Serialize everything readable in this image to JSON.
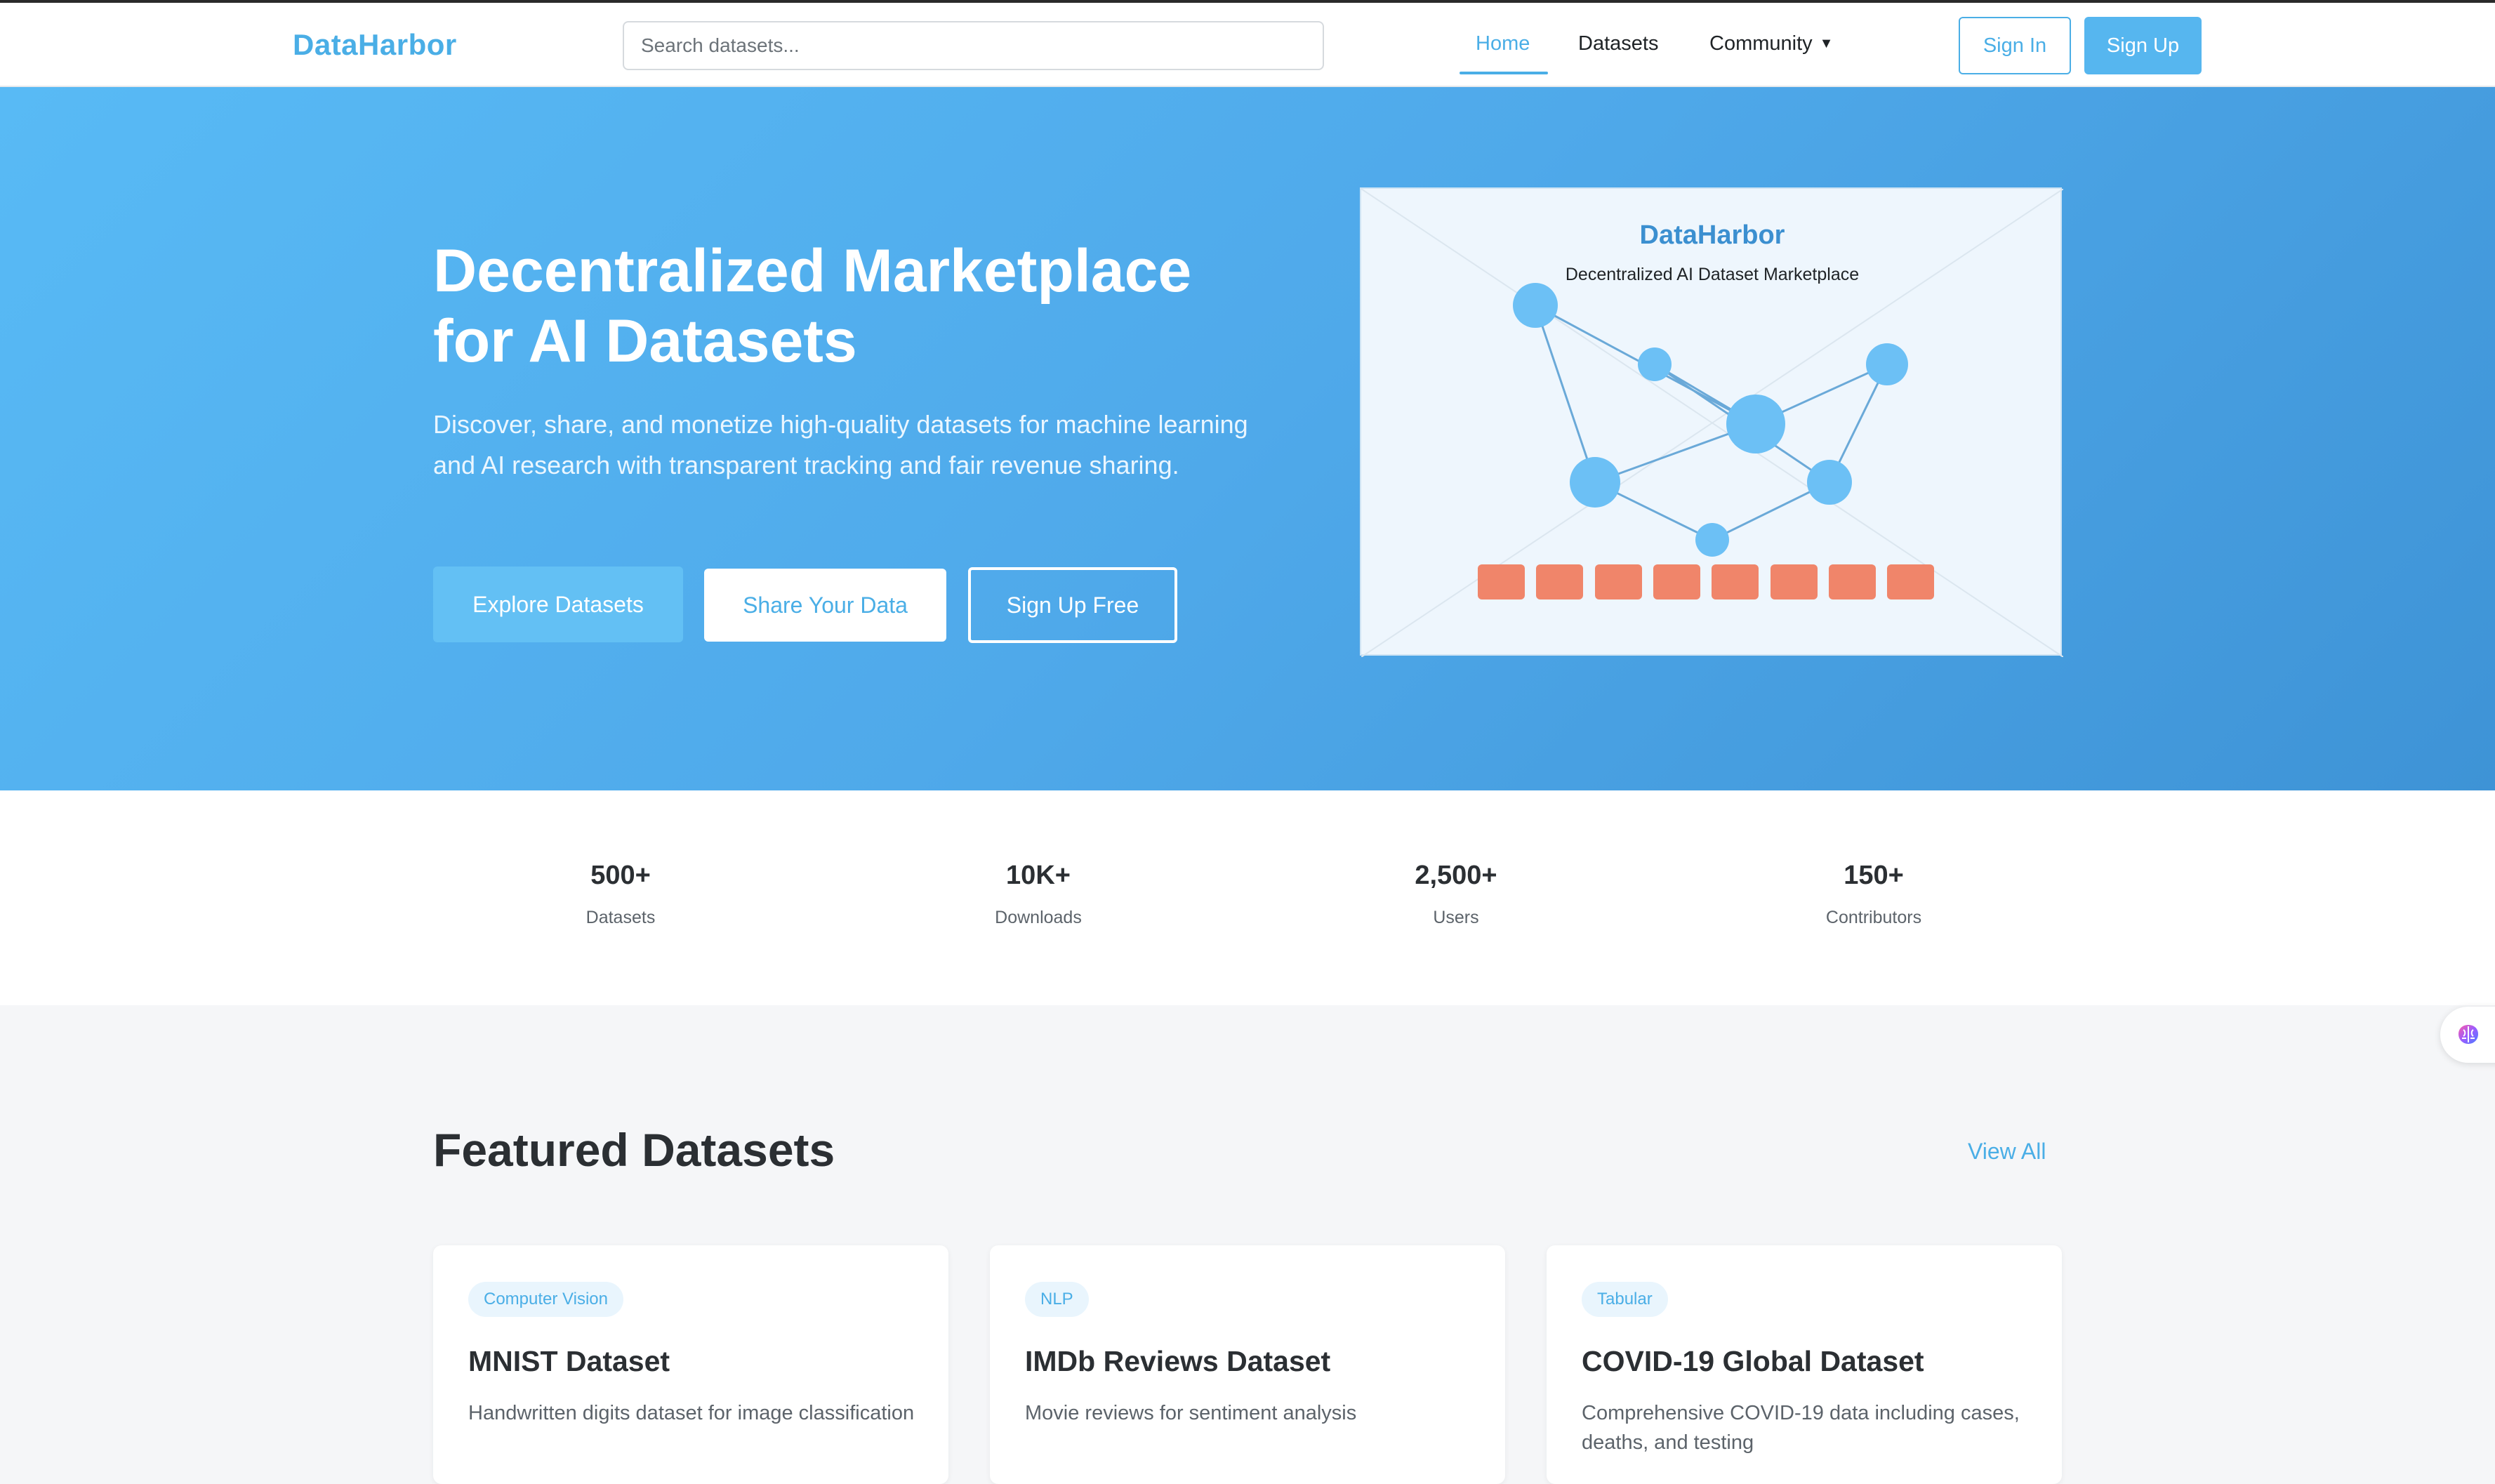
{
  "brand": "DataHarbor",
  "search": {
    "placeholder": "Search datasets..."
  },
  "nav": {
    "home": "Home",
    "datasets": "Datasets",
    "community": "Community",
    "community_caret": "▼",
    "sign_in": "Sign In",
    "sign_up": "Sign Up"
  },
  "hero": {
    "title_line1": "Decentralized Marketplace",
    "title_line2": "for AI Datasets",
    "subtitle": "Discover, share, and monetize high-quality datasets for machine learning and AI research with transparent tracking and fair revenue sharing.",
    "btn_explore": "Explore Datasets",
    "btn_share": "Share Your Data",
    "btn_free": "Sign Up Free",
    "illustration": {
      "title": "DataHarbor",
      "subtitle": "Decentralized AI Dataset Marketplace"
    }
  },
  "stats": [
    {
      "value": "500+",
      "label": "Datasets"
    },
    {
      "value": "10K+",
      "label": "Downloads"
    },
    {
      "value": "2,500+",
      "label": "Users"
    },
    {
      "value": "150+",
      "label": "Contributors"
    }
  ],
  "featured": {
    "title": "Featured Datasets",
    "view_all": "View All",
    "cards": [
      {
        "tag": "Computer Vision",
        "title": "MNIST Dataset",
        "description": "Handwritten digits dataset for image classification"
      },
      {
        "tag": "NLP",
        "title": "IMDb Reviews Dataset",
        "description": "Movie reviews for sentiment analysis"
      },
      {
        "tag": "Tabular",
        "title": "COVID-19 Global Dataset",
        "description": "Comprehensive COVID-19 data including cases, deaths, and testing"
      }
    ]
  },
  "colors": {
    "accent": "#4aaee6",
    "hero_gradient_start": "#58baf5",
    "hero_gradient_end": "#3e93d6",
    "block_color": "#f0856a",
    "node_color": "#6cc0f5"
  },
  "icons": {
    "floating": "brain-icon"
  }
}
